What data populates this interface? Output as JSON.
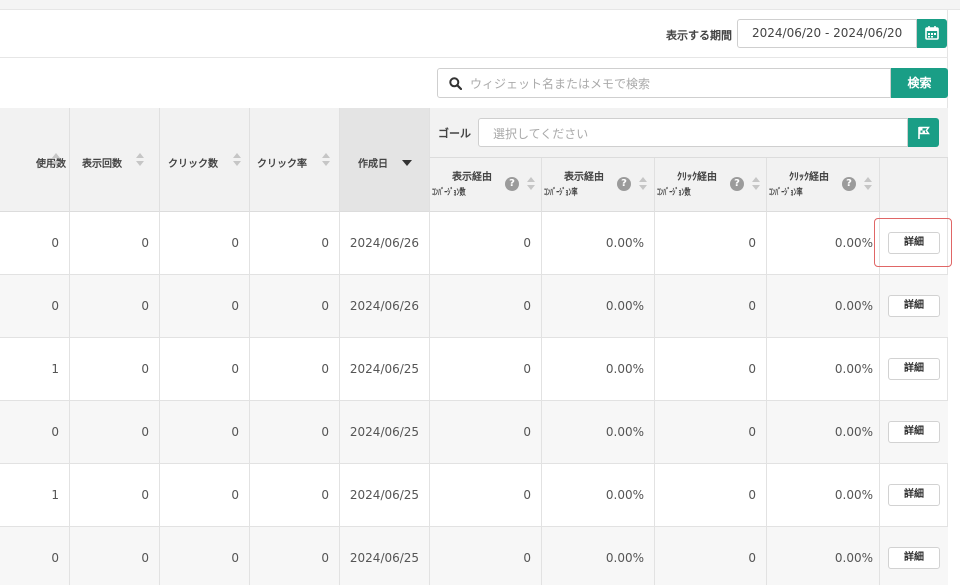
{
  "period": {
    "label": "表示する期間",
    "value": "2024/06/20 - 2024/06/20"
  },
  "search": {
    "placeholder": "ウィジェット名またはメモで検索",
    "button_label": "検索"
  },
  "columns": {
    "usage": "使用数",
    "impressions": "表示回数",
    "clicks": "クリック数",
    "ctr": "クリック率",
    "created": "作成日"
  },
  "goal": {
    "label": "ゴール",
    "placeholder": "選択してください"
  },
  "sub_columns": {
    "view_conv_count": {
      "line1": "表示経由",
      "line2": "ｺﾝﾊﾞｰｼﾞｮﾝ数"
    },
    "view_conv_rate": {
      "line1": "表示経由",
      "line2": "ｺﾝﾊﾞｰｼﾞｮﾝ率"
    },
    "click_conv_count": {
      "line1": "ｸﾘｯｸ経由",
      "line2": "ｺﾝﾊﾞｰｼﾞｮﾝ数"
    },
    "click_conv_rate": {
      "line1": "ｸﾘｯｸ経由",
      "line2": "ｺﾝﾊﾞｰｼﾞｮﾝ率"
    },
    "help_glyph": "?"
  },
  "rows": [
    {
      "usage": "0",
      "impressions": "0",
      "clicks": "0",
      "ctr": "0",
      "created": "2024/06/26",
      "view_conv_count": "0",
      "view_conv_rate": "0.00%",
      "click_conv_count": "0",
      "click_conv_rate": "0.00%",
      "detail": "詳細"
    },
    {
      "usage": "0",
      "impressions": "0",
      "clicks": "0",
      "ctr": "0",
      "created": "2024/06/26",
      "view_conv_count": "0",
      "view_conv_rate": "0.00%",
      "click_conv_count": "0",
      "click_conv_rate": "0.00%",
      "detail": "詳細"
    },
    {
      "usage": "1",
      "impressions": "0",
      "clicks": "0",
      "ctr": "0",
      "created": "2024/06/25",
      "view_conv_count": "0",
      "view_conv_rate": "0.00%",
      "click_conv_count": "0",
      "click_conv_rate": "0.00%",
      "detail": "詳細"
    },
    {
      "usage": "0",
      "impressions": "0",
      "clicks": "0",
      "ctr": "0",
      "created": "2024/06/25",
      "view_conv_count": "0",
      "view_conv_rate": "0.00%",
      "click_conv_count": "0",
      "click_conv_rate": "0.00%",
      "detail": "詳細"
    },
    {
      "usage": "1",
      "impressions": "0",
      "clicks": "0",
      "ctr": "0",
      "created": "2024/06/25",
      "view_conv_count": "0",
      "view_conv_rate": "0.00%",
      "click_conv_count": "0",
      "click_conv_rate": "0.00%",
      "detail": "詳細"
    },
    {
      "usage": "0",
      "impressions": "0",
      "clicks": "0",
      "ctr": "0",
      "created": "2024/06/25",
      "view_conv_count": "0",
      "view_conv_rate": "0.00%",
      "click_conv_count": "0",
      "click_conv_rate": "0.00%",
      "detail": "詳細"
    }
  ],
  "colors": {
    "accent": "#1a9e86",
    "header_bg": "#f2f2f2",
    "highlight": "#e06666"
  },
  "icons": {
    "period": "calendar-icon",
    "search": "search-icon",
    "goal": "flag-icon"
  }
}
